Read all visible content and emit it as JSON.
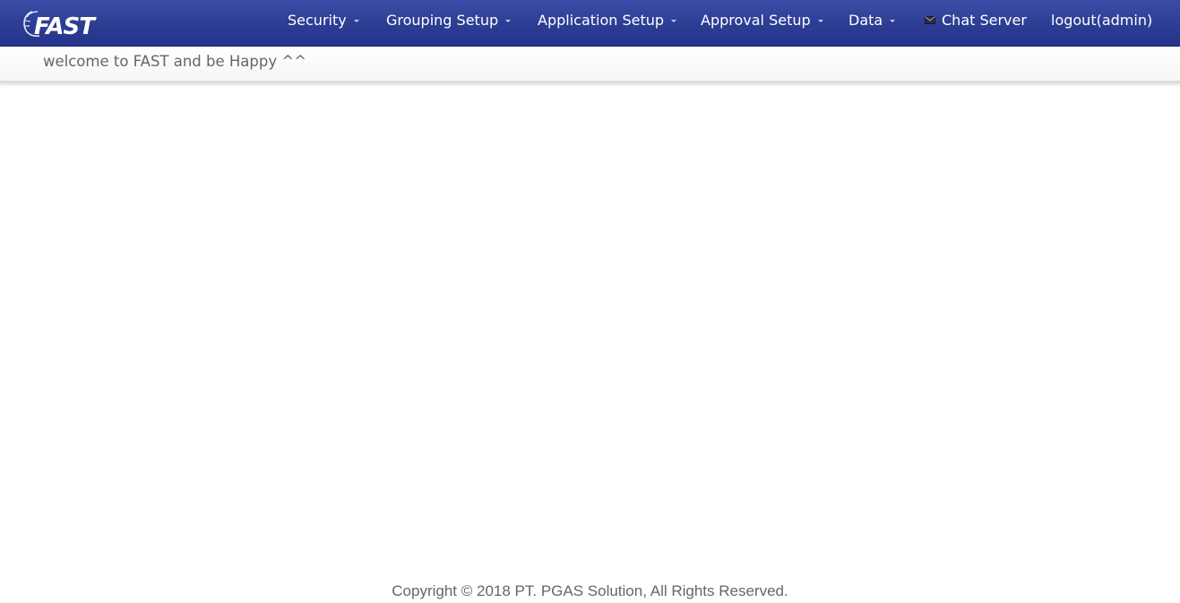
{
  "brand": {
    "logo_text": "FAST",
    "logo_icon": "fast-swoosh-logo"
  },
  "nav": {
    "items": [
      {
        "label": "Security",
        "has_dropdown": true
      },
      {
        "label": "Grouping Setup",
        "has_dropdown": true
      },
      {
        "label": "Application Setup",
        "has_dropdown": true
      },
      {
        "label": "Approval Setup",
        "has_dropdown": true
      },
      {
        "label": "Data",
        "has_dropdown": true
      }
    ],
    "chat": {
      "label": "Chat Server",
      "icon": "envelope-icon"
    },
    "logout": {
      "label": "logout(admin)"
    }
  },
  "welcome": {
    "message": "welcome to FAST and be Happy ^^"
  },
  "footer": {
    "copyright": "Copyright © 2018 PT. PGAS Solution, All Rights Reserved."
  },
  "colors": {
    "navbar": "#2c3d93",
    "nav_text": "#ffffff",
    "body_text": "#666666",
    "background": "#ffffff"
  }
}
